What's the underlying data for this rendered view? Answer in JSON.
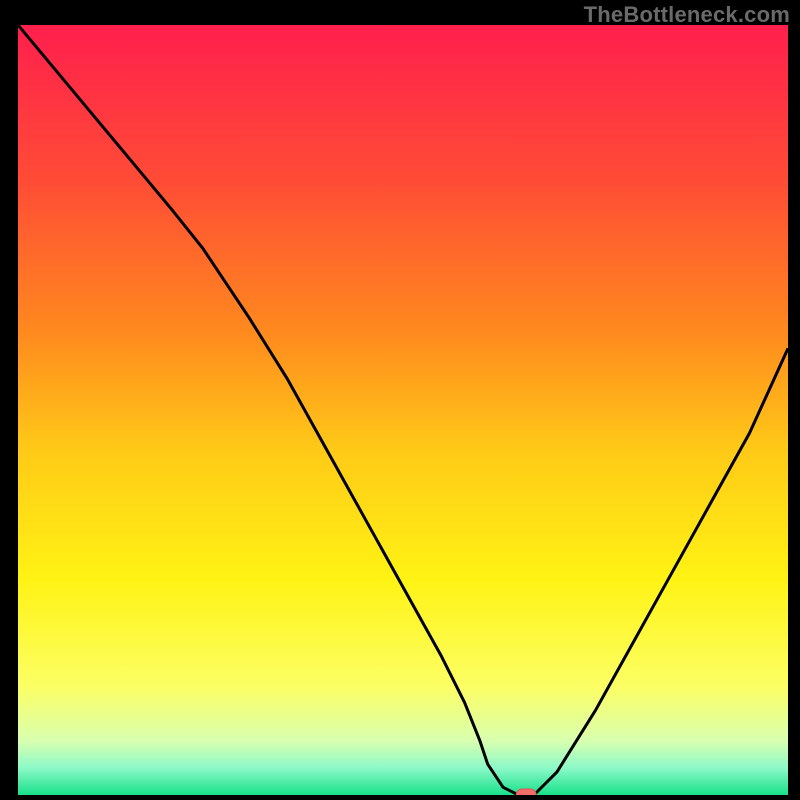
{
  "watermark": "TheBottleneck.com",
  "colors": {
    "axis": "#000000",
    "curve": "#000000",
    "marker_fill": "#f26e6a",
    "marker_stroke": "#e4534f"
  },
  "chart_data": {
    "type": "line",
    "title": "",
    "xlabel": "",
    "ylabel": "",
    "xlim": [
      0,
      100
    ],
    "ylim": [
      0,
      100
    ],
    "gradient_stops": [
      {
        "offset": 0.0,
        "color": "#ff1f4d"
      },
      {
        "offset": 0.2,
        "color": "#ff4b36"
      },
      {
        "offset": 0.4,
        "color": "#ff8a1e"
      },
      {
        "offset": 0.55,
        "color": "#ffc917"
      },
      {
        "offset": 0.72,
        "color": "#fff314"
      },
      {
        "offset": 0.86,
        "color": "#fcff65"
      },
      {
        "offset": 0.93,
        "color": "#d8ffb0"
      },
      {
        "offset": 0.965,
        "color": "#8cf9c8"
      },
      {
        "offset": 1.0,
        "color": "#18e08a"
      }
    ],
    "series": [
      {
        "name": "bottleneck-curve",
        "x": [
          0,
          5,
          10,
          15,
          20,
          24,
          26,
          30,
          35,
          40,
          45,
          50,
          55,
          58,
          60,
          61,
          63,
          65,
          67,
          70,
          75,
          80,
          85,
          90,
          95,
          100
        ],
        "y": [
          100,
          94,
          88,
          82,
          76,
          71,
          68,
          62,
          54,
          45,
          36,
          27,
          18,
          12,
          7,
          4,
          1,
          0,
          0,
          3,
          11,
          20,
          29,
          38,
          47,
          58
        ]
      }
    ],
    "marker": {
      "x": 66,
      "y": 0,
      "rx": 10,
      "ry": 6
    }
  }
}
